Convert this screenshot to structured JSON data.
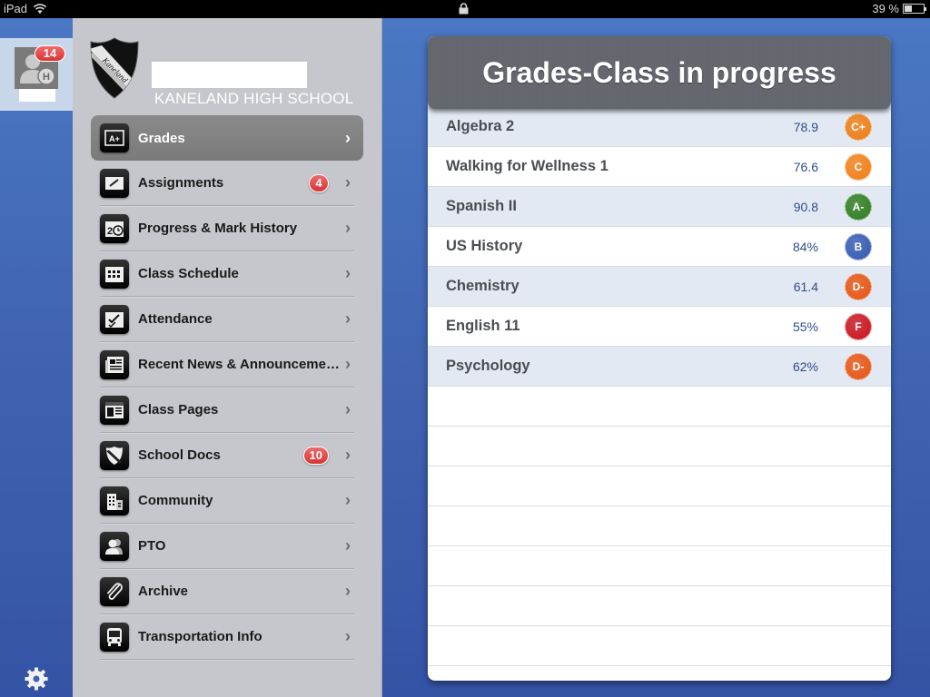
{
  "status_bar": {
    "device": "iPad",
    "wifi_icon": "wifi-icon",
    "lock_icon": "lock-icon",
    "battery_percent": "39 %",
    "battery_level": 0.39
  },
  "rail": {
    "notification_count": "14",
    "profile_letter": "H",
    "settings_icon": "gear-icon"
  },
  "school": {
    "name": "KANELAND HIGH SCHOOL",
    "crest_text": "Kaneland"
  },
  "menu": [
    {
      "label": "Grades",
      "icon": "grades-icon",
      "badge": null,
      "active": true
    },
    {
      "label": "Assignments",
      "icon": "assignments-icon",
      "badge": "4",
      "active": false
    },
    {
      "label": "Progress & Mark History",
      "icon": "progress-history-icon",
      "badge": null,
      "active": false
    },
    {
      "label": "Class Schedule",
      "icon": "calendar-icon",
      "badge": null,
      "active": false
    },
    {
      "label": "Attendance",
      "icon": "attendance-icon",
      "badge": null,
      "active": false
    },
    {
      "label": "Recent News & Announcements",
      "icon": "news-icon",
      "badge": null,
      "active": false
    },
    {
      "label": "Class Pages",
      "icon": "class-pages-icon",
      "badge": null,
      "active": false
    },
    {
      "label": "School Docs",
      "icon": "shield-icon",
      "badge": "10",
      "active": false
    },
    {
      "label": "Community",
      "icon": "building-icon",
      "badge": null,
      "active": false
    },
    {
      "label": "PTO",
      "icon": "people-icon",
      "badge": null,
      "active": false
    },
    {
      "label": "Archive",
      "icon": "paperclip-icon",
      "badge": null,
      "active": false
    },
    {
      "label": "Transportation Info",
      "icon": "bus-icon",
      "badge": null,
      "active": false
    }
  ],
  "grades": {
    "title": "Grades-Class in progress",
    "rows": [
      {
        "course": "Algebra 2",
        "score": "78.9",
        "grade": "C+",
        "color": "#f07c12"
      },
      {
        "course": "Walking for Wellness 1",
        "score": "76.6",
        "grade": "C",
        "color": "#f07c12"
      },
      {
        "course": "Spanish II",
        "score": "90.8",
        "grade": "A-",
        "color": "#2e7d1e"
      },
      {
        "course": "US History",
        "score": "84%",
        "grade": "B",
        "color": "#2f56b0"
      },
      {
        "course": "Chemistry",
        "score": "61.4",
        "grade": "D-",
        "color": "#e8530f"
      },
      {
        "course": "English 11",
        "score": "55%",
        "grade": "F",
        "color": "#c8101a"
      },
      {
        "course": "Psychology",
        "score": "62%",
        "grade": "D-",
        "color": "#e8530f"
      }
    ]
  }
}
